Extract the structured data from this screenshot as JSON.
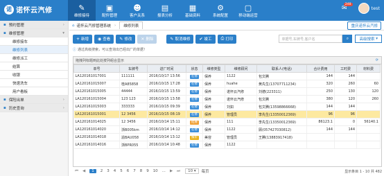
{
  "app": {
    "logo_mark": "诺",
    "name": "诺怀云汽修"
  },
  "nav": [
    {
      "label": "维修接待",
      "icon": "✎",
      "icon_name": "wrench-icon"
    },
    {
      "label": "配件管理",
      "icon": "▣",
      "icon_name": "parts-icon"
    },
    {
      "label": "客户关系",
      "icon": "☻",
      "icon_name": "users-icon"
    },
    {
      "label": "报表分析",
      "icon": "▤",
      "icon_name": "report-icon"
    },
    {
      "label": "基础资料",
      "icon": "▦",
      "icon_name": "data-icon"
    },
    {
      "label": "系统配置",
      "icon": "⚙",
      "icon_name": "gear-icon"
    },
    {
      "label": "移动端运营",
      "icon": "▢",
      "icon_name": "mobile-icon"
    }
  ],
  "topright": {
    "msg_badge": "248",
    "bell_icon": "✉",
    "username": "test"
  },
  "sidebar": [
    {
      "label": "预约管理",
      "type": "grp",
      "expanded": false
    },
    {
      "label": "维修管理",
      "type": "grp",
      "expanded": true
    },
    {
      "label": "维修接车",
      "type": "sub",
      "active": false
    },
    {
      "label": "维修列表",
      "type": "sub",
      "active": true
    },
    {
      "label": "维修派工",
      "type": "sub",
      "active": false
    },
    {
      "label": "结算",
      "type": "sub",
      "active": false
    },
    {
      "label": "收银",
      "type": "sub",
      "active": false
    },
    {
      "label": "快速洗车",
      "type": "sub",
      "active": false
    },
    {
      "label": "用户看板",
      "type": "sub",
      "active": false
    },
    {
      "label": "保险出单",
      "type": "grp",
      "expanded": false
    },
    {
      "label": "历史查询",
      "type": "grp",
      "expanded": false
    }
  ],
  "breadcrumb": {
    "home": "诺怀云汽修管理系统",
    "tab": "维修列表",
    "current_store": "重庆诺怀云汽修"
  },
  "toolbar": {
    "buttons": [
      {
        "label": "新增",
        "icon": "+",
        "disabled": false
      },
      {
        "label": "查看",
        "icon": "◉",
        "disabled": false
      },
      {
        "label": "修改",
        "icon": "✎",
        "disabled": false
      },
      {
        "label": "删除",
        "icon": "✕",
        "disabled": true
      },
      {
        "label": "取消维修",
        "icon": "✎",
        "disabled": false
      },
      {
        "label": "竣工",
        "icon": "✔",
        "disabled": false
      },
      {
        "label": "打印",
        "icon": "⎙",
        "disabled": false
      }
    ],
    "search_placeholder": "单据号,车牌号,客户名",
    "adv_search": "高级搜索"
  },
  "tip": "通过高级搜索，可以查询出已经出厂的单据！",
  "grid": {
    "group_hint": "拖拽列标题到此处按列组合显示",
    "columns": [
      "单号",
      "车牌号",
      "进厂时间",
      "状态",
      "维修类型",
      "维修顾问",
      "联系人(电话)",
      "合计费用",
      "工时费",
      "材料费"
    ],
    "rows": [
      {
        "id": "LA120161017001",
        "plate": "111111",
        "time": "2016/10/17 13:56",
        "status": "在修",
        "status_color": "b-blue",
        "type": "保养",
        "advisor": "1122",
        "contact": "包文腾",
        "total": "144",
        "labor": "144",
        "material": "",
        "sel": false
      },
      {
        "id": "LA120161015007",
        "plate": "桂A85858",
        "time": "2016/10/15 17:28",
        "status": "在修",
        "status_color": "b-blue",
        "type": "保养",
        "advisor": "huahe",
        "contact": "黄先生(13707711234)",
        "total": "320",
        "labor": "260",
        "material": "60",
        "sel": false
      },
      {
        "id": "LA120161015005",
        "plate": "44444",
        "time": "2016/10/15 13:59",
        "status": "在修",
        "status_color": "b-blue",
        "type": "保养",
        "advisor": "诺怀云汽修",
        "contact": "刘德(223311)",
        "total": "250",
        "labor": "130",
        "material": "120",
        "sel": false
      },
      {
        "id": "LA120161015004",
        "plate": "123 123",
        "time": "2016/10/15 13:58",
        "status": "在修",
        "status_color": "b-blue",
        "type": "保养",
        "advisor": "诺怀云汽修",
        "contact": "包文腾",
        "total": "380",
        "labor": "120",
        "material": "260",
        "sel": false
      },
      {
        "id": "LA120161015003",
        "plate": "333333",
        "time": "2016/10/15 09:39",
        "status": "在修",
        "status_color": "b-blue",
        "type": "保养",
        "advisor": "刘如",
        "contact": "包文腾(13598866668)",
        "total": "144",
        "labor": "144",
        "material": "",
        "sel": false
      },
      {
        "id": "LA120161015001",
        "plate": "12 3456",
        "time": "2016/10/15 08:19",
        "status": "在修",
        "status_color": "b-blue",
        "type": "保养",
        "advisor": "管理员",
        "contact": "李先生(13350012369)",
        "total": "96",
        "labor": "96",
        "material": "",
        "sel": true
      },
      {
        "id": "LA120161014025",
        "plate": "12 3456",
        "time": "2016/10/14 15:11",
        "status": "结算",
        "status_color": "b-orange",
        "type": "保养",
        "advisor": "111",
        "contact": "李先生(13350012369)",
        "total": "86123.1",
        "labor": "0",
        "material": "56140.1",
        "sel": false
      },
      {
        "id": "LA120161014020",
        "plate": "浙B005km",
        "time": "2016/10/14 14:12",
        "status": "在修",
        "status_color": "b-blue",
        "type": "保养",
        "advisor": "1122",
        "contact": "顾(057427030812)",
        "total": "144",
        "labor": "144",
        "material": "",
        "sel": false
      },
      {
        "id": "LA120161014018",
        "plate": "渝BAU058",
        "time": "2016/10/14 13:12",
        "status": "报价",
        "status_color": "b-yellow",
        "type": "美容",
        "advisor": "管理员",
        "contact": "王腾(13883917418)",
        "total": "",
        "labor": "",
        "material": "",
        "sel": false
      },
      {
        "id": "LA120161014016",
        "plate": "浙BPR055",
        "time": "2016/10/14 10:48",
        "status": "在修",
        "status_color": "b-blue",
        "type": "保养",
        "advisor": "1122",
        "contact": "",
        "total": "",
        "labor": "",
        "material": "",
        "sel": false
      }
    ]
  },
  "pager": {
    "pages": [
      "1",
      "2",
      "3",
      "4",
      "5",
      "6",
      "7",
      "8",
      "9",
      "10",
      "..."
    ],
    "current": "1",
    "page_size": "10",
    "page_size_label": "每页",
    "summary": "显示条目 1 - 10 共 482"
  }
}
